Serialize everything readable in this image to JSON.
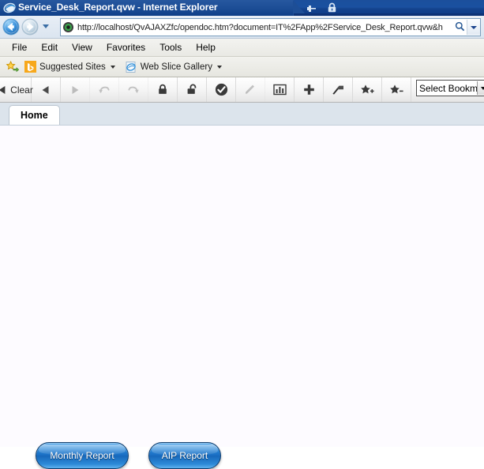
{
  "window": {
    "title": "Service_Desk_Report.qvw - Internet Explorer",
    "logo_icon": "internet-explorer-logo",
    "pin_icon": "pin-icon",
    "lock_icon": "lock-icon"
  },
  "address_bar": {
    "back_icon": "back-arrow-icon",
    "forward_icon": "forward-arrow-icon",
    "history_icon": "recent-pages-chevron-icon",
    "favicon": "site-favicon",
    "url": "http://localhost/QvAJAXZfc/opendoc.htm?document=IT%2FApp%2FService_Desk_Report.qvw&h",
    "search_icon": "search-icon",
    "dropdown_icon": "address-dropdown-icon"
  },
  "menu_bar": {
    "items": [
      {
        "label": "File"
      },
      {
        "label": "Edit"
      },
      {
        "label": "View"
      },
      {
        "label": "Favorites"
      },
      {
        "label": "Tools"
      },
      {
        "label": "Help"
      }
    ]
  },
  "favorites_bar": {
    "favorites_icon": "add-to-favorites-star-icon",
    "items": [
      {
        "label": "Suggested Sites",
        "icon": "bing-icon",
        "has_caret": true
      },
      {
        "label": "Web Slice Gallery",
        "icon": "internet-explorer-icon",
        "has_caret": true
      }
    ]
  },
  "qv_toolbar": {
    "clear_label": "Clear",
    "buttons": [
      {
        "name": "clear-button",
        "icon": "clear-selections-icon",
        "enabled": true
      },
      {
        "name": "back-button",
        "icon": "step-back-icon",
        "enabled": true
      },
      {
        "name": "forward-button",
        "icon": "step-forward-icon",
        "enabled": false
      },
      {
        "name": "undo-button",
        "icon": "undo-icon",
        "enabled": false
      },
      {
        "name": "redo-button",
        "icon": "redo-icon",
        "enabled": false
      },
      {
        "name": "lock-button",
        "icon": "lock-closed-icon",
        "enabled": true
      },
      {
        "name": "unlock-button",
        "icon": "lock-open-icon",
        "enabled": true
      },
      {
        "name": "current-selections-button",
        "icon": "check-circle-icon",
        "enabled": true
      },
      {
        "name": "annotate-button",
        "icon": "pencil-icon",
        "enabled": false
      },
      {
        "name": "chart-button",
        "icon": "bar-chart-icon",
        "enabled": true
      },
      {
        "name": "add-button",
        "icon": "plus-icon",
        "enabled": true
      },
      {
        "name": "highlight-button",
        "icon": "magic-wand-icon",
        "enabled": true
      },
      {
        "name": "add-bookmark-button",
        "icon": "star-add-icon",
        "enabled": true
      },
      {
        "name": "remove-bookmark-button",
        "icon": "star-remove-icon",
        "enabled": true
      }
    ],
    "bookmark_select": {
      "value": "Select Bookmark",
      "arrow_icon": "dropdown-arrow-icon"
    }
  },
  "sheet_tabs": {
    "tabs": [
      {
        "label": "Home",
        "active": true
      }
    ]
  },
  "sheet": {
    "buttons": [
      {
        "id": "btn-monthly",
        "name": "monthly-report-button",
        "label": "Monthly Report"
      },
      {
        "id": "btn-aip",
        "name": "aip-report-button",
        "label": "AIP Report"
      }
    ]
  },
  "colors": {
    "titlebar": "#1a50a0",
    "button_blue": "#1a6fc4",
    "button_border": "#0e3d6e",
    "tabstrip_bg": "#dce4ec",
    "content_bg": "#fdfbff"
  }
}
